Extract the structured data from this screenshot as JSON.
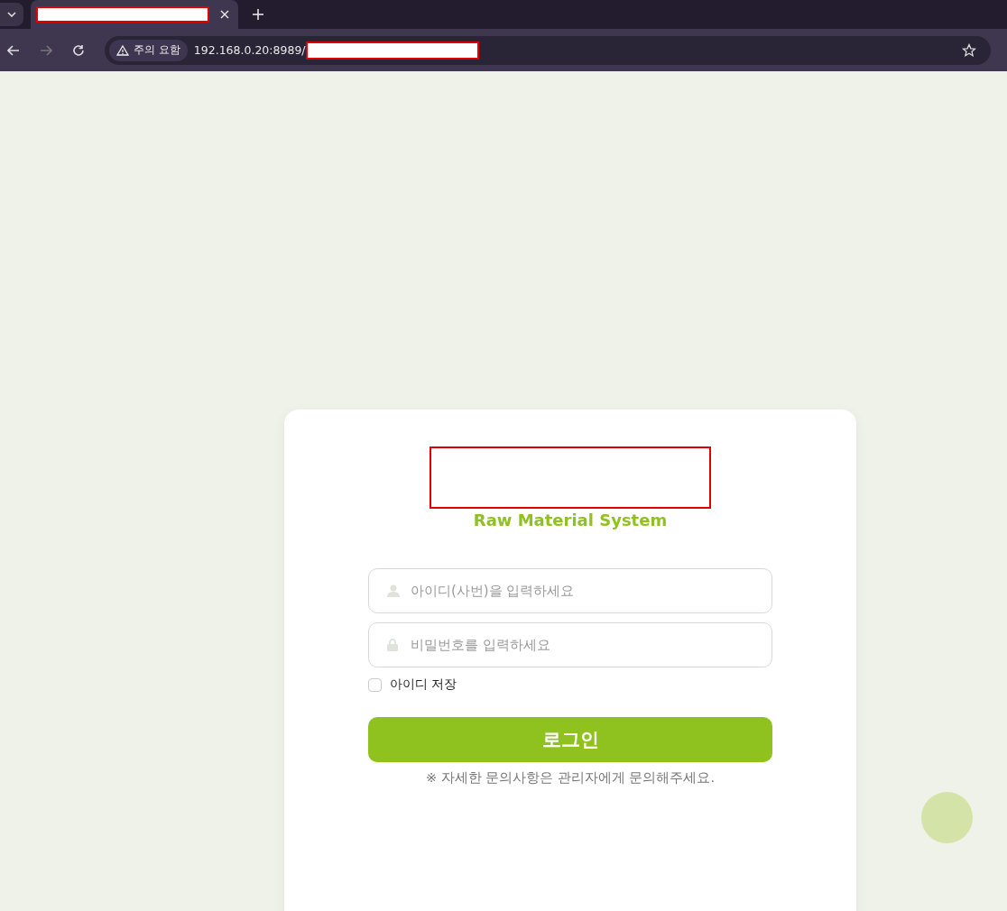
{
  "browser": {
    "security_label": "주의 요함",
    "url_host": "192.168.0.20:8989/"
  },
  "login": {
    "subtitle": "Raw Material System",
    "fields": [
      {
        "kind": "user",
        "placeholder": "아이디(사번)을 입력하세요"
      },
      {
        "kind": "password",
        "placeholder": "비밀번호를 입력하세요"
      }
    ],
    "remember": {
      "label": "아이디 저장",
      "checked": false
    },
    "button": "로그인",
    "note": "※ 자세한 문의사항은 관리자에게 문의해주세요."
  }
}
